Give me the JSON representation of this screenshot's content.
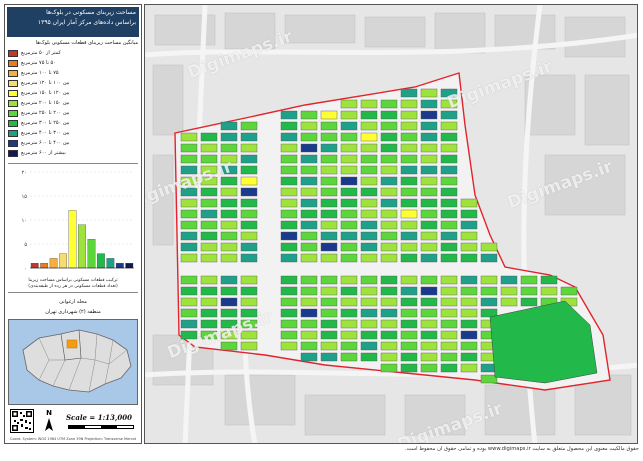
{
  "title": {
    "line1": "مساحت زیربنای مسکونی در بلوک‌ها",
    "line2": "براساس داده‌های مرکز آمار ایران ۱۳۹۵"
  },
  "legend": {
    "heading": "میانگین مساحت زیربنای قطعات مسکونی بلوک‌ها",
    "classes": [
      {
        "label": "کمتر از ۵۰ مترمربع",
        "color": "#c0392b"
      },
      {
        "label": "۵۰ تا ۷۵ مترمربع",
        "color": "#e67e22"
      },
      {
        "label": "۷۵ تا ۱۰۰ مترمربع",
        "color": "#f5b041"
      },
      {
        "label": "بین ۱۰۰ تا ۱۲۰ مترمربع",
        "color": "#f7dc6f"
      },
      {
        "label": "بین ۱۲۰ تا ۱۵۰ مترمربع",
        "color": "#ffff33"
      },
      {
        "label": "بین ۱۵۰ تا ۲۰۰ مترمربع",
        "color": "#9ee23c"
      },
      {
        "label": "بین ۲۰۰ تا ۲۵۰ مترمربع",
        "color": "#5cd63a"
      },
      {
        "label": "بین ۲۵۰ تا ۳۰۰ مترمربع",
        "color": "#22b84a"
      },
      {
        "label": "بین ۳۰۰ تا ۴۰۰ مترمربع",
        "color": "#1fa088"
      },
      {
        "label": "بین ۴۰۰ تا ۶۰۰ مترمربع",
        "color": "#1a3a8c"
      },
      {
        "label": "بیشتر از ۶۰۰ مترمربع",
        "color": "#111a55"
      }
    ]
  },
  "histogram": {
    "values": [
      1,
      1,
      2,
      3,
      12,
      9,
      6,
      3,
      2,
      1,
      1
    ],
    "ytick_labels": [
      "۲۰",
      "۱۵",
      "۱۰",
      "۵",
      "۰"
    ],
    "caption_line1": "ترکیب قطعات مسکونی براساس مساحت زیربنا",
    "caption_line2": "(تعداد قطعات مسکونی در هر رده از طبقه‌بندی)"
  },
  "location": {
    "line1": "محله ارغوانی",
    "line2": "منطقه (۲) شهرداری تهران",
    "water_color": "#a9c7e6",
    "city_color": "#dedede",
    "highlight_color": "#f39c12"
  },
  "footer": {
    "north_label": "N",
    "scale_label": "Scale = 1:13,000",
    "coord_text": "Coord. System: WGS 1984 UTM Zone 39N   Projection: Transverse Mercator"
  },
  "map": {
    "watermark": "Digimaps.ir",
    "boundary_color": "#e0252d",
    "credit": "حقوق مالکیت معنوی این محصول متعلق به سایت www.digimaps.ir بوده و تمامی حقوق آن محفوظ است."
  }
}
